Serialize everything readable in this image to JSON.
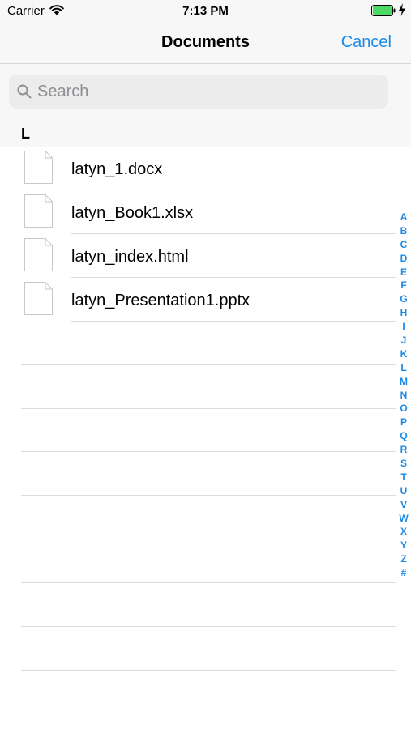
{
  "status_bar": {
    "carrier": "Carrier",
    "time": "7:13 PM"
  },
  "nav": {
    "title": "Documents",
    "cancel_label": "Cancel"
  },
  "search": {
    "placeholder": "Search",
    "value": ""
  },
  "section": {
    "letter": "L"
  },
  "files": [
    {
      "name": "latyn_1.docx",
      "icon": "document-icon"
    },
    {
      "name": "latyn_Book1.xlsx",
      "icon": "document-icon"
    },
    {
      "name": "latyn_index.html",
      "icon": "document-icon"
    },
    {
      "name": "latyn_Presentation1.pptx",
      "icon": "document-icon"
    }
  ],
  "index": [
    "A",
    "B",
    "C",
    "D",
    "E",
    "F",
    "G",
    "H",
    "I",
    "J",
    "K",
    "L",
    "M",
    "N",
    "O",
    "P",
    "Q",
    "R",
    "S",
    "T",
    "U",
    "V",
    "W",
    "X",
    "Y",
    "Z",
    "#"
  ],
  "colors": {
    "accent": "#1b8ae6",
    "battery": "#4cd964",
    "bar_background": "#f7f7f7"
  }
}
